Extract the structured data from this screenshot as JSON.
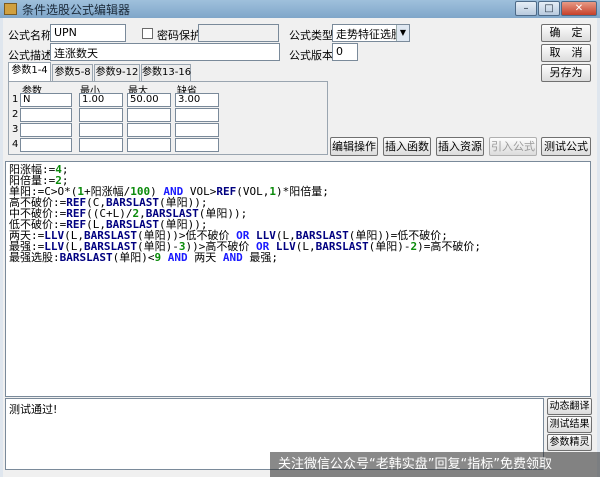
{
  "window": {
    "title": "条件选股公式编辑器"
  },
  "form": {
    "name_label": "公式名称",
    "name_value": "UPN",
    "password_label": "密码保护",
    "type_label": "公式类型",
    "type_value": "走势特征选股",
    "desc_label": "公式描述",
    "desc_value": "连涨数天",
    "version_label": "公式版本",
    "version_value": "0"
  },
  "buttons": {
    "ok": "确　定",
    "cancel": "取　消",
    "save_as": "另存为",
    "edit_ops": "编辑操作",
    "insert_func": "插入函数",
    "insert_res": "插入资源",
    "import": "引入公式",
    "test": "测试公式",
    "dyn_translate": "动态翻译",
    "test_result": "测试结果",
    "param_wizard": "参数精灵"
  },
  "tabs": [
    "参数1-4",
    "参数5-8",
    "参数9-12",
    "参数13-16"
  ],
  "params": {
    "headers": [
      "参数",
      "最小",
      "最大",
      "缺省"
    ],
    "rows": [
      {
        "num": "1",
        "name": "N",
        "min": "1.00",
        "max": "50.00",
        "def": "3.00"
      },
      {
        "num": "2",
        "name": "",
        "min": "",
        "max": "",
        "def": ""
      },
      {
        "num": "3",
        "name": "",
        "min": "",
        "max": "",
        "def": ""
      },
      {
        "num": "4",
        "name": "",
        "min": "",
        "max": "",
        "def": ""
      }
    ]
  },
  "code": [
    [
      [
        "t",
        "阳涨幅:="
      ],
      [
        "n",
        "4"
      ],
      [
        "t",
        ";"
      ]
    ],
    [
      [
        "t",
        "阳倍量:="
      ],
      [
        "n",
        "2"
      ],
      [
        "t",
        ";"
      ]
    ],
    [
      [
        "t",
        "单阳:=C>O*("
      ],
      [
        "n",
        "1"
      ],
      [
        "t",
        "+阳涨幅/"
      ],
      [
        "n",
        "100"
      ],
      [
        "t",
        ") "
      ],
      [
        "k",
        "AND"
      ],
      [
        "t",
        " VOL>"
      ],
      [
        "f",
        "REF"
      ],
      [
        "t",
        "(VOL,"
      ],
      [
        "n",
        "1"
      ],
      [
        "t",
        ")*阳倍量;"
      ]
    ],
    [
      [
        "t",
        "高不破价:="
      ],
      [
        "f",
        "REF"
      ],
      [
        "t",
        "(C,"
      ],
      [
        "f",
        "BARSLAST"
      ],
      [
        "t",
        "(单阳));"
      ]
    ],
    [
      [
        "t",
        "中不破价:="
      ],
      [
        "f",
        "REF"
      ],
      [
        "t",
        "((C+L)/"
      ],
      [
        "n",
        "2"
      ],
      [
        "t",
        ","
      ],
      [
        "f",
        "BARSLAST"
      ],
      [
        "t",
        "(单阳));"
      ]
    ],
    [
      [
        "t",
        "低不破价:="
      ],
      [
        "f",
        "REF"
      ],
      [
        "t",
        "(L,"
      ],
      [
        "f",
        "BARSLAST"
      ],
      [
        "t",
        "(单阳));"
      ]
    ],
    [
      [
        "t",
        "两天:="
      ],
      [
        "f",
        "LLV"
      ],
      [
        "t",
        "(L,"
      ],
      [
        "f",
        "BARSLAST"
      ],
      [
        "t",
        "(单阳))>低不破价 "
      ],
      [
        "k",
        "OR"
      ],
      [
        "t",
        " "
      ],
      [
        "f",
        "LLV"
      ],
      [
        "t",
        "(L,"
      ],
      [
        "f",
        "BARSLAST"
      ],
      [
        "t",
        "(单阳))=低不破价;"
      ]
    ],
    [
      [
        "t",
        "最强:="
      ],
      [
        "f",
        "LLV"
      ],
      [
        "t",
        "(L,"
      ],
      [
        "f",
        "BARSLAST"
      ],
      [
        "t",
        "(单阳)-"
      ],
      [
        "n",
        "3"
      ],
      [
        "t",
        "))>高不破价 "
      ],
      [
        "k",
        "OR"
      ],
      [
        "t",
        " "
      ],
      [
        "f",
        "LLV"
      ],
      [
        "t",
        "(L,"
      ],
      [
        "f",
        "BARSLAST"
      ],
      [
        "t",
        "(单阳)-"
      ],
      [
        "n",
        "2"
      ],
      [
        "t",
        ")=高不破价;"
      ]
    ],
    [
      [
        "t",
        "最强选股:"
      ],
      [
        "f",
        "BARSLAST"
      ],
      [
        "t",
        "(单阳)<"
      ],
      [
        "n",
        "9"
      ],
      [
        "t",
        " "
      ],
      [
        "k",
        "AND"
      ],
      [
        "t",
        " 两天 "
      ],
      [
        "k",
        "AND"
      ],
      [
        "t",
        " 最强;"
      ]
    ]
  ],
  "output": {
    "text": "测试通过!"
  },
  "watermark": {
    "text": "关注微信公众号“老韩实盘”回复“指标”免费领取"
  }
}
